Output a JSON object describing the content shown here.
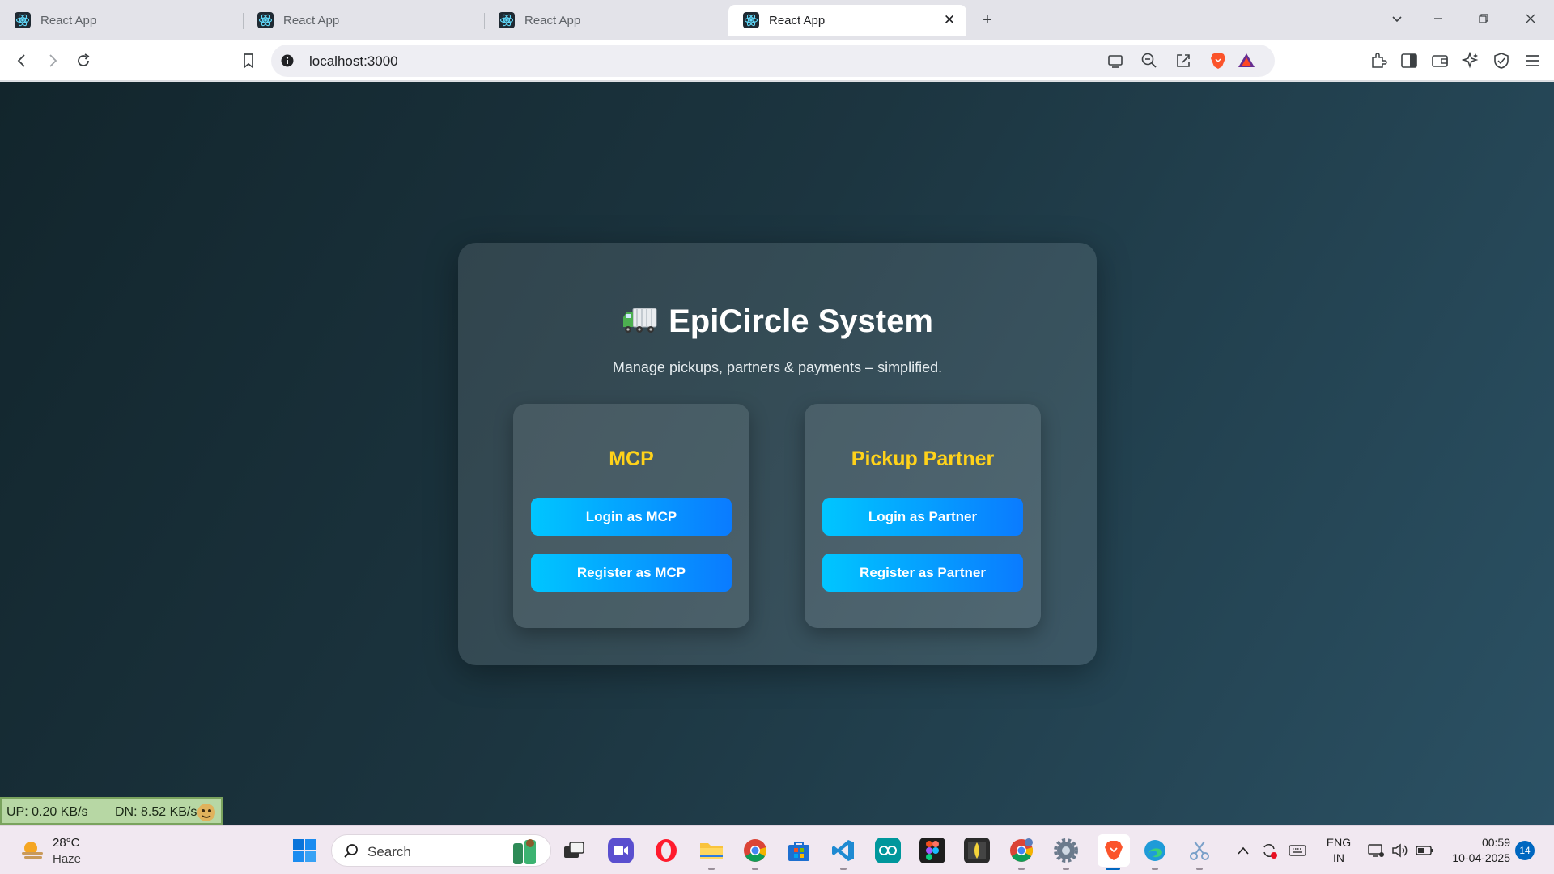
{
  "browser": {
    "tabs": [
      {
        "title": "React App",
        "active": false
      },
      {
        "title": "React App",
        "active": false
      },
      {
        "title": "React App",
        "active": false
      },
      {
        "title": "React App",
        "active": true
      }
    ],
    "address": "localhost:3000"
  },
  "page": {
    "title": "EpiCircle System",
    "subtitle": "Manage pickups, partners & payments – simplified.",
    "roles": [
      {
        "title": "MCP",
        "login_label": "Login as MCP",
        "register_label": "Register as MCP"
      },
      {
        "title": "Pickup Partner",
        "login_label": "Login as Partner",
        "register_label": "Register as Partner"
      }
    ],
    "colors": {
      "accent": "#ffd21a",
      "button_start": "#00c6ff",
      "button_end": "#0a7bff"
    }
  },
  "netmeter": {
    "up": "UP: 0.20 KB/s",
    "down": "DN: 8.52 KB/s"
  },
  "taskbar": {
    "weather": {
      "temp": "28°C",
      "desc": "Haze"
    },
    "search_label": "Search",
    "tray": {
      "lang": "ENG",
      "region": "IN",
      "time": "00:59",
      "date": "10-04-2025",
      "notifications": "14"
    }
  }
}
